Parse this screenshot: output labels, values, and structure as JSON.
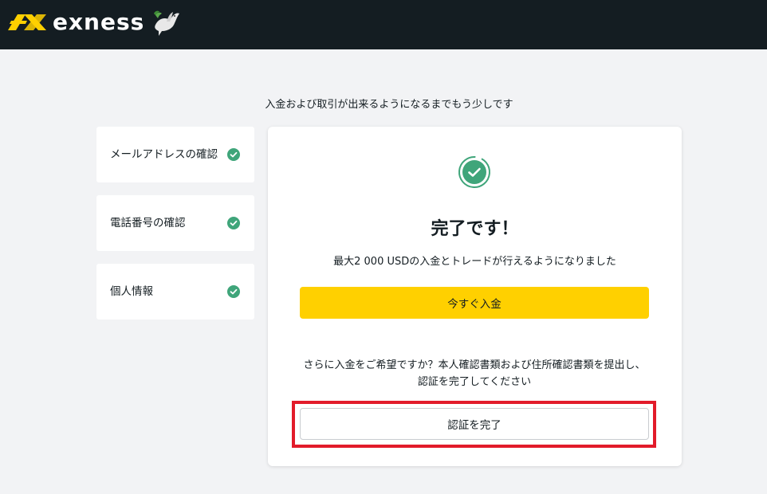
{
  "header": {
    "brand": "exness",
    "logo_icon": "exness-logo-icon",
    "mascot_icon": "dove-icon",
    "background_color": "#141d22"
  },
  "page": {
    "subtitle": "入金および取引が出来るようになるまでもう少しです"
  },
  "steps": [
    {
      "label": "メールアドレスの確認",
      "status": "complete",
      "icon": "check-circle-icon"
    },
    {
      "label": "電話番号の確認",
      "status": "complete",
      "icon": "check-circle-icon"
    },
    {
      "label": "個人情報",
      "status": "complete",
      "icon": "check-circle-icon"
    }
  ],
  "card": {
    "icon": "success-check-icon",
    "title": "完了です！",
    "description": "最大2 000 USDの入金とトレードが行えるようになりました",
    "deposit_button": "今すぐ入金",
    "note": "さらに入金をご希望ですか？本人確認書類および住所確認書類を提出し、認証を完了してください",
    "verify_button": "認証を完了"
  },
  "colors": {
    "accent_yellow": "#ffd000",
    "success_green": "#3fa57a",
    "highlight_red": "#e21b2a"
  }
}
